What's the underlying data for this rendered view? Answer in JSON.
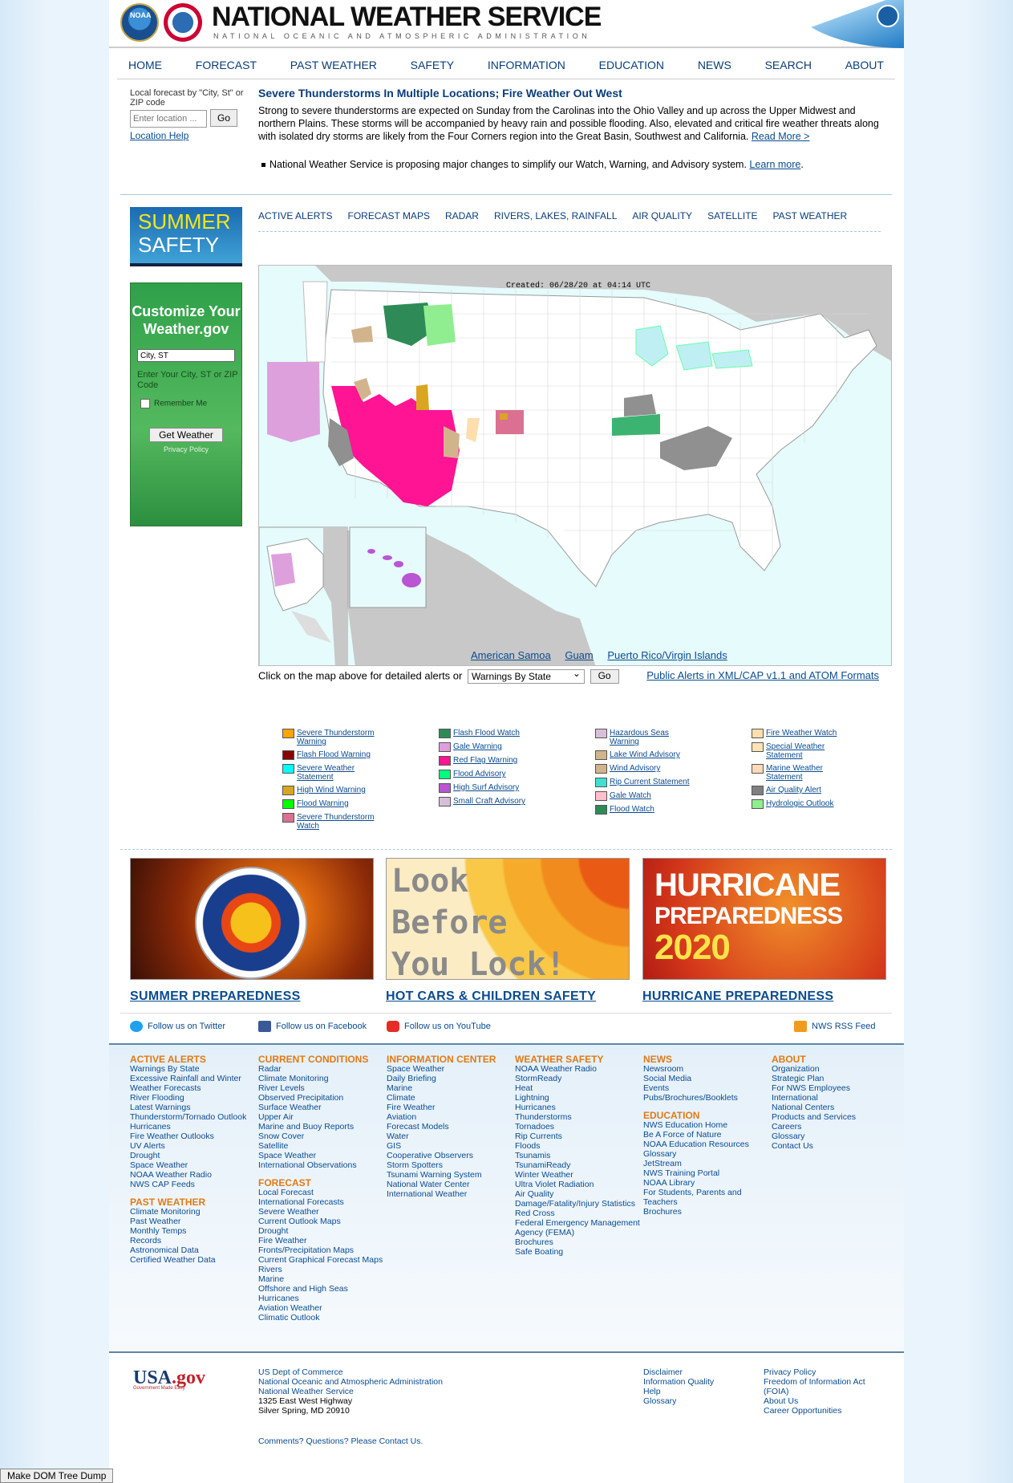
{
  "header": {
    "title": "NATIONAL WEATHER SERVICE",
    "subtitle": "NATIONAL OCEANIC AND ATMOSPHERIC ADMINISTRATION",
    "noaa_logo_text": "NOAA"
  },
  "nav": [
    "HOME",
    "FORECAST",
    "PAST WEATHER",
    "SAFETY",
    "INFORMATION",
    "EDUCATION",
    "NEWS",
    "SEARCH",
    "ABOUT"
  ],
  "local_forecast": {
    "label": "Local forecast by \"City, St\" or ZIP code",
    "placeholder": "Enter location ...",
    "go": "Go",
    "help": "Location Help"
  },
  "news": {
    "headline": "Severe Thunderstorms In Multiple Locations; Fire Weather Out West",
    "body": "Strong to severe thunderstorms are expected on Sunday from the Carolinas into the Ohio Valley and up across the Upper Midwest and northern Plains. These storms will be accompanied by heavy rain and possible flooding. Also, elevated and critical fire weather threats along with isolated dry storms are likely from the Four Corners region into the Great Basin, Southwest and California.",
    "read_more": "Read More >",
    "bullet": "National Weather Service is proposing major changes to simplify our Watch, Warning, and Advisory system.",
    "learn_more": "Learn more"
  },
  "summer_tile": {
    "line1": "SUMMER",
    "line2": "SAFETY"
  },
  "customize": {
    "title": "Customize Your Weather.gov",
    "input_value": "City, ST",
    "hint": "Enter Your City, ST or ZIP Code",
    "remember": "Remember Me",
    "button": "Get Weather",
    "privacy": "Privacy Policy"
  },
  "tabs": [
    "ACTIVE ALERTS",
    "FORECAST MAPS",
    "RADAR",
    "RIVERS, LAKES, RAINFALL",
    "AIR QUALITY",
    "SATELLITE",
    "PAST WEATHER"
  ],
  "map": {
    "created": "Created: 06/28/20 at 04:14 UTC",
    "links": [
      "American Samoa",
      "Guam",
      "Puerto Rico/Virgin Islands"
    ],
    "click_text": "Click on the map above for detailed alerts or",
    "select_value": "Warnings By State",
    "go": "Go",
    "xml_link": "Public Alerts in XML/CAP v1.1 and ATOM Formats"
  },
  "legend": [
    [
      {
        "label": "Severe Thunderstorm Warning",
        "color": "#ffa500"
      },
      {
        "label": "Flash Flood Warning",
        "color": "#8b0000"
      },
      {
        "label": "Severe Weather Statement",
        "color": "#00ffff"
      },
      {
        "label": "High Wind Warning",
        "color": "#daa520"
      },
      {
        "label": "Flood Warning",
        "color": "#00ff00"
      },
      {
        "label": "Severe Thunderstorm Watch",
        "color": "#db7093"
      }
    ],
    [
      {
        "label": "Flash Flood Watch",
        "color": "#2e8b57"
      },
      {
        "label": "Gale Warning",
        "color": "#dda0dd"
      },
      {
        "label": "Red Flag Warning",
        "color": "#ff1493"
      },
      {
        "label": "Flood Advisory",
        "color": "#00ff7f"
      },
      {
        "label": "High Surf Advisory",
        "color": "#ba55d3"
      },
      {
        "label": "Small Craft Advisory",
        "color": "#d8bfd8"
      }
    ],
    [
      {
        "label": "Hazardous Seas Warning",
        "color": "#d8bfd8"
      },
      {
        "label": "Lake Wind Advisory",
        "color": "#d2b48c"
      },
      {
        "label": "Wind Advisory",
        "color": "#d2b48c"
      },
      {
        "label": "Rip Current Statement",
        "color": "#40e0d0"
      },
      {
        "label": "Gale Watch",
        "color": "#ffc0cb"
      },
      {
        "label": "Flood Watch",
        "color": "#2e8b57"
      }
    ],
    [
      {
        "label": "Fire Weather Watch",
        "color": "#ffdead"
      },
      {
        "label": "Special Weather Statement",
        "color": "#ffe4b5"
      },
      {
        "label": "Marine Weather Statement",
        "color": "#ffdab9"
      },
      {
        "label": "Air Quality Alert",
        "color": "#808080"
      },
      {
        "label": "Hydrologic Outlook",
        "color": "#90ee90"
      }
    ]
  ],
  "promos": [
    {
      "caption": "SUMMER PREPAREDNESS"
    },
    {
      "caption": "HOT CARS & CHILDREN SAFETY",
      "image_text": [
        "Look",
        "Before",
        "You Lock!"
      ]
    },
    {
      "caption": "HURRICANE PREPAREDNESS",
      "image_text": [
        "HURRICANE",
        "PREPAREDNESS",
        "2020"
      ]
    }
  ],
  "social": {
    "twitter": "Follow us on Twitter",
    "facebook": "Follow us on Facebook",
    "youtube": "Follow us on YouTube",
    "rss": "NWS RSS Feed"
  },
  "sitemap": [
    {
      "sections": [
        {
          "title": "ACTIVE ALERTS",
          "links": [
            "Warnings By State",
            "Excessive Rainfall and Winter Weather Forecasts",
            "River Flooding",
            "Latest Warnings",
            "Thunderstorm/Tornado Outlook",
            "Hurricanes",
            "Fire Weather Outlooks",
            "UV Alerts",
            "Drought",
            "Space Weather",
            "NOAA Weather Radio",
            "NWS CAP Feeds"
          ]
        },
        {
          "title": "PAST WEATHER",
          "links": [
            "Climate Monitoring",
            "Past Weather",
            "Monthly Temps",
            "Records",
            "Astronomical Data",
            "Certified Weather Data"
          ]
        }
      ]
    },
    {
      "sections": [
        {
          "title": "CURRENT CONDITIONS",
          "links": [
            "Radar",
            "Climate Monitoring",
            "River Levels",
            "Observed Precipitation",
            "Surface Weather",
            "Upper Air",
            "Marine and Buoy Reports",
            "Snow Cover",
            "Satellite",
            "Space Weather",
            "International Observations"
          ]
        },
        {
          "title": "FORECAST",
          "links": [
            "Local Forecast",
            "International Forecasts",
            "Severe Weather",
            "Current Outlook Maps",
            "Drought",
            "Fire Weather",
            "Fronts/Precipitation Maps",
            "Current Graphical Forecast Maps",
            "Rivers",
            "Marine",
            "Offshore and High Seas",
            "Hurricanes",
            "Aviation Weather",
            "Climatic Outlook"
          ]
        }
      ]
    },
    {
      "sections": [
        {
          "title": "INFORMATION CENTER",
          "links": [
            "Space Weather",
            "Daily Briefing",
            "Marine",
            "Climate",
            "Fire Weather",
            "Aviation",
            "Forecast Models",
            "Water",
            "GIS",
            "Cooperative Observers",
            "Storm Spotters",
            "Tsunami Warning System",
            "National Water Center",
            "International Weather"
          ]
        }
      ]
    },
    {
      "sections": [
        {
          "title": "WEATHER SAFETY",
          "links": [
            "NOAA Weather Radio",
            "StormReady",
            "Heat",
            "Lightning",
            "Hurricanes",
            "Thunderstorms",
            "Tornadoes",
            "Rip Currents",
            "Floods",
            "Tsunamis",
            "TsunamiReady",
            "Winter Weather",
            "Ultra Violet Radiation",
            "Air Quality",
            "Damage/Fatality/Injury Statistics",
            "Red Cross",
            "Federal Emergency Management Agency (FEMA)",
            "Brochures",
            "Safe Boating"
          ]
        }
      ]
    },
    {
      "sections": [
        {
          "title": "NEWS",
          "links": [
            "Newsroom",
            "Social Media",
            "Events",
            "Pubs/Brochures/Booklets"
          ]
        },
        {
          "title": "EDUCATION",
          "links": [
            "NWS Education Home",
            "Be A Force of Nature",
            "NOAA Education Resources",
            "Glossary",
            "JetStream",
            "NWS Training Portal",
            "NOAA Library",
            "For Students, Parents and Teachers",
            "Brochures"
          ]
        }
      ]
    },
    {
      "sections": [
        {
          "title": "ABOUT",
          "links": [
            "Organization",
            "Strategic Plan",
            "For NWS Employees",
            "International",
            "National Centers",
            "Products and Services",
            "Careers",
            "Glossary",
            "Contact Us"
          ]
        }
      ]
    }
  ],
  "footer": {
    "usagov": "USA",
    "usagov_tld": ".gov",
    "usagov_tag": "Government Made Easy",
    "address": [
      "US Dept of Commerce",
      "National Oceanic and Atmospheric Administration",
      "National Weather Service",
      "1325 East West Highway",
      "Silver Spring, MD 20910"
    ],
    "links1": [
      "Disclaimer",
      "Information Quality",
      "Help",
      "Glossary"
    ],
    "links2": [
      "Privacy Policy",
      "Freedom of Information Act (FOIA)",
      "About Us",
      "Career Opportunities"
    ],
    "comments": "Comments? Questions? Please Contact Us."
  },
  "dom_dump_button": "Make DOM Tree Dump"
}
